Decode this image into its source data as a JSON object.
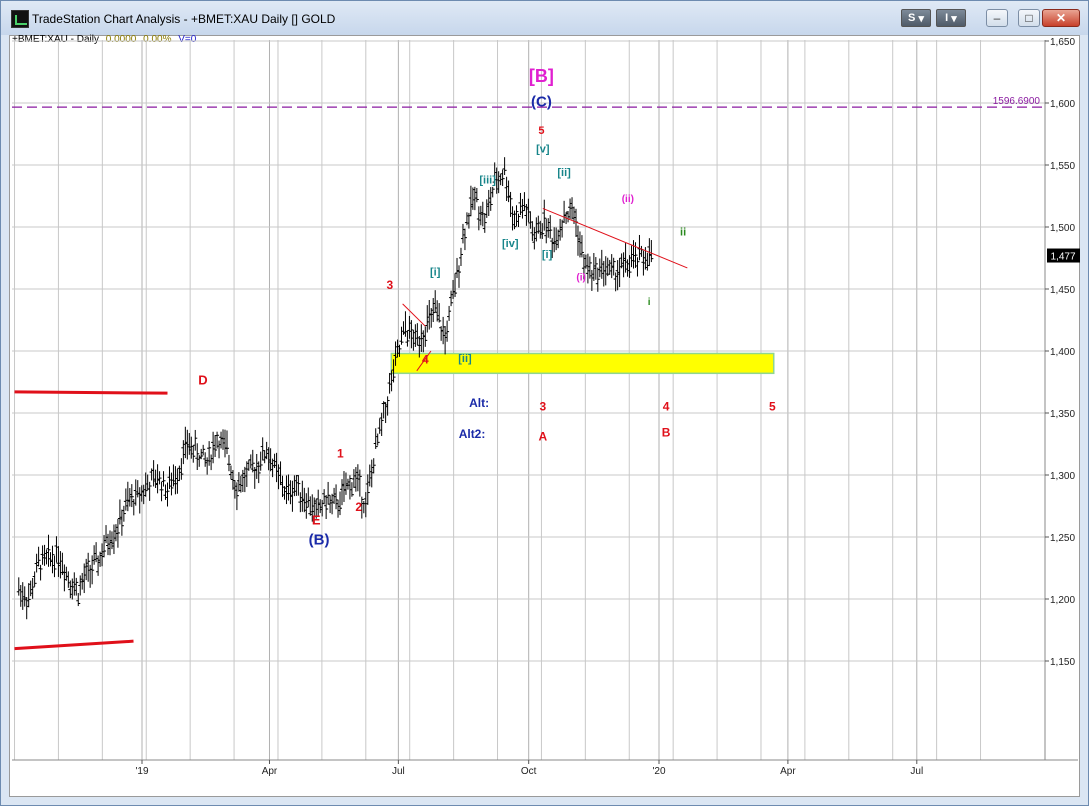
{
  "window": {
    "title": "TradeStation Chart Analysis - +BMET:XAU Daily [] GOLD",
    "s_button": "S",
    "i_button": "I",
    "minimize": "–",
    "maximize": "□",
    "close": "✕"
  },
  "header": {
    "symbol": "+BMET:XAU - Daily",
    "change": "0.0000",
    "change_pct": "0.00%",
    "volume": "V=0"
  },
  "colors": {
    "grid": "#c8c8c8",
    "bars": "#000000",
    "red": "#e0101a",
    "teal": "#17858a",
    "magenta": "#e020d0",
    "navy": "#1a2aa8",
    "green": "#2a8a1e",
    "zone": "#ffff00",
    "level": "#8a1aa0"
  },
  "chart_data": {
    "type": "ohlc",
    "ylim": [
      1100,
      1660
    ],
    "yticks": [
      "1,650",
      "1,600",
      "1,550",
      "1,500",
      "1,450",
      "1,400",
      "1,350",
      "1,300",
      "1,250",
      "1,200",
      "1,150"
    ],
    "ytick_values": [
      1650,
      1600,
      1550,
      1500,
      1450,
      1400,
      1350,
      1300,
      1250,
      1200,
      1150
    ],
    "xticks": [
      "'19",
      "Apr",
      "Jul",
      "Oct",
      "'20",
      "Apr",
      "Jul"
    ],
    "xtick_days": [
      0,
      90,
      181,
      273,
      365,
      456,
      547
    ],
    "xlim_days": [
      -90,
      620
    ],
    "last_price": "1,477",
    "level_value": 1596.69,
    "level_label": "1596.6900",
    "zone": {
      "from_day": 176,
      "to_day": 446,
      "low": 1382,
      "high": 1398
    },
    "trendline": {
      "from": [
        283,
        1515
      ],
      "to": [
        385,
        1467
      ]
    },
    "wave4_line": {
      "from": [
        184,
        1438
      ],
      "to": [
        200,
        1420
      ]
    },
    "red_levels": [
      {
        "from_day": -90,
        "to_day": 18,
        "value": 1367
      },
      {
        "from_day": -90,
        "to_day": -6,
        "value": 1160
      }
    ],
    "closes": [
      {
        "d": -87,
        "c": 1208
      },
      {
        "d": -80,
        "c": 1200
      },
      {
        "d": -73,
        "c": 1228
      },
      {
        "d": -66,
        "c": 1232
      },
      {
        "d": -59,
        "c": 1236
      },
      {
        "d": -52,
        "c": 1218
      },
      {
        "d": -45,
        "c": 1206
      },
      {
        "d": -38,
        "c": 1222
      },
      {
        "d": -31,
        "c": 1230
      },
      {
        "d": -24,
        "c": 1248
      },
      {
        "d": -17,
        "c": 1258
      },
      {
        "d": -10,
        "c": 1278
      },
      {
        "d": -3,
        "c": 1283
      },
      {
        "d": 4,
        "c": 1292
      },
      {
        "d": 11,
        "c": 1298
      },
      {
        "d": 18,
        "c": 1288
      },
      {
        "d": 25,
        "c": 1302
      },
      {
        "d": 32,
        "c": 1325
      },
      {
        "d": 39,
        "c": 1318
      },
      {
        "d": 46,
        "c": 1310
      },
      {
        "d": 53,
        "c": 1330
      },
      {
        "d": 60,
        "c": 1318
      },
      {
        "d": 67,
        "c": 1290
      },
      {
        "d": 74,
        "c": 1300
      },
      {
        "d": 81,
        "c": 1308
      },
      {
        "d": 88,
        "c": 1320
      },
      {
        "d": 95,
        "c": 1302
      },
      {
        "d": 102,
        "c": 1285
      },
      {
        "d": 109,
        "c": 1292
      },
      {
        "d": 116,
        "c": 1280
      },
      {
        "d": 123,
        "c": 1270
      },
      {
        "d": 130,
        "c": 1280
      },
      {
        "d": 137,
        "c": 1275
      },
      {
        "d": 144,
        "c": 1288
      },
      {
        "d": 151,
        "c": 1298
      },
      {
        "d": 158,
        "c": 1276
      },
      {
        "d": 165,
        "c": 1320
      },
      {
        "d": 172,
        "c": 1355
      },
      {
        "d": 179,
        "c": 1390
      },
      {
        "d": 186,
        "c": 1418
      },
      {
        "d": 193,
        "c": 1408
      },
      {
        "d": 200,
        "c": 1418
      },
      {
        "d": 207,
        "c": 1432
      },
      {
        "d": 214,
        "c": 1410
      },
      {
        "d": 221,
        "c": 1452
      },
      {
        "d": 228,
        "c": 1500
      },
      {
        "d": 235,
        "c": 1525
      },
      {
        "d": 242,
        "c": 1505
      },
      {
        "d": 249,
        "c": 1535
      },
      {
        "d": 256,
        "c": 1545
      },
      {
        "d": 263,
        "c": 1505
      },
      {
        "d": 270,
        "c": 1518
      },
      {
        "d": 277,
        "c": 1492
      },
      {
        "d": 284,
        "c": 1505
      },
      {
        "d": 291,
        "c": 1488
      },
      {
        "d": 298,
        "c": 1510
      },
      {
        "d": 305,
        "c": 1512
      },
      {
        "d": 312,
        "c": 1470
      },
      {
        "d": 319,
        "c": 1462
      },
      {
        "d": 326,
        "c": 1468
      },
      {
        "d": 333,
        "c": 1462
      },
      {
        "d": 340,
        "c": 1468
      },
      {
        "d": 347,
        "c": 1472
      },
      {
        "d": 354,
        "c": 1476
      },
      {
        "d": 361,
        "c": 1477
      }
    ],
    "annotations": [
      {
        "t": "[B]",
        "d": 282,
        "v": 1617,
        "c": "magenta",
        "s": 18
      },
      {
        "t": "(C)",
        "d": 282,
        "v": 1597,
        "c": "navy",
        "s": 15
      },
      {
        "t": "5",
        "d": 282,
        "v": 1575,
        "c": "red",
        "s": 11
      },
      {
        "t": "[v]",
        "d": 283,
        "v": 1560,
        "c": "teal",
        "s": 11
      },
      {
        "t": "[iii]",
        "d": 244,
        "v": 1535,
        "c": "teal",
        "s": 11
      },
      {
        "t": "[ii]",
        "d": 298,
        "v": 1541,
        "c": "teal",
        "s": 11
      },
      {
        "t": "(ii)",
        "d": 343,
        "v": 1520,
        "c": "magenta",
        "s": 10
      },
      {
        "t": "[iv]",
        "d": 260,
        "v": 1484,
        "c": "teal",
        "s": 11
      },
      {
        "t": "[i]",
        "d": 286,
        "v": 1475,
        "c": "teal",
        "s": 11
      },
      {
        "t": "ii",
        "d": 382,
        "v": 1493,
        "c": "green",
        "s": 11
      },
      {
        "t": "(i)",
        "d": 310,
        "v": 1457,
        "c": "magenta",
        "s": 10
      },
      {
        "t": "i",
        "d": 358,
        "v": 1437,
        "c": "green",
        "s": 10
      },
      {
        "t": "3",
        "d": 175,
        "v": 1450,
        "c": "red",
        "s": 12
      },
      {
        "t": "[i]",
        "d": 207,
        "v": 1461,
        "c": "teal",
        "s": 11
      },
      {
        "t": "4",
        "d": 200,
        "v": 1390,
        "c": "red",
        "s": 12
      },
      {
        "t": "[ii]",
        "d": 228,
        "v": 1391,
        "c": "teal",
        "s": 11
      },
      {
        "t": "Alt:",
        "d": 238,
        "v": 1355,
        "c": "navy",
        "s": 12
      },
      {
        "t": "3",
        "d": 283,
        "v": 1352,
        "c": "red",
        "s": 12
      },
      {
        "t": "4",
        "d": 370,
        "v": 1352,
        "c": "red",
        "s": 12
      },
      {
        "t": "5",
        "d": 445,
        "v": 1352,
        "c": "red",
        "s": 12
      },
      {
        "t": "Alt2:",
        "d": 233,
        "v": 1330,
        "c": "navy",
        "s": 12
      },
      {
        "t": "A",
        "d": 283,
        "v": 1328,
        "c": "red",
        "s": 12
      },
      {
        "t": "B",
        "d": 370,
        "v": 1331,
        "c": "red",
        "s": 12
      },
      {
        "t": "D",
        "d": 43,
        "v": 1373,
        "c": "red",
        "s": 13
      },
      {
        "t": "1",
        "d": 140,
        "v": 1314,
        "c": "red",
        "s": 12
      },
      {
        "t": "2",
        "d": 153,
        "v": 1271,
        "c": "red",
        "s": 12
      },
      {
        "t": "E",
        "d": 123,
        "v": 1260,
        "c": "red",
        "s": 13
      },
      {
        "t": "(B)",
        "d": 125,
        "v": 1244,
        "c": "navy",
        "s": 15
      }
    ]
  }
}
